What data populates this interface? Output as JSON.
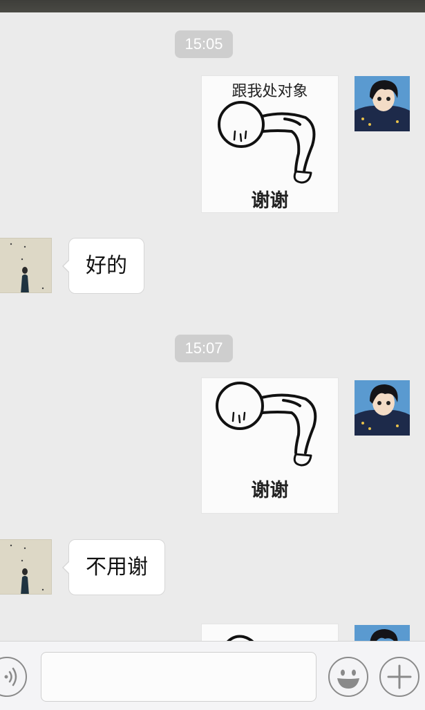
{
  "messages": {
    "time1": "15:05",
    "sticker1": {
      "top_caption": "跟我处对象",
      "bottom_caption": "谢谢"
    },
    "reply1": "好的",
    "time2": "15:07",
    "sticker2": {
      "bottom_caption": "谢谢"
    },
    "reply2": "不用谢"
  },
  "input_bar": {
    "text_value": "",
    "placeholder": ""
  },
  "icons": {
    "voice": "voice-wave-icon",
    "emoji": "smiley-face-icon",
    "more": "plus-icon"
  },
  "colors": {
    "background": "#ebebeb",
    "timestamp_pill": "#cecece",
    "bubble": "#ffffff"
  }
}
